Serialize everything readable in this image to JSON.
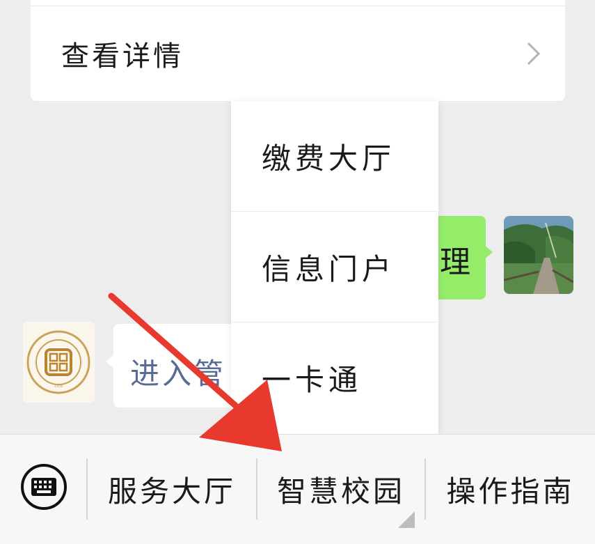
{
  "card": {
    "row_label": "查看详情",
    "chevron_icon": "chevron-right-icon"
  },
  "chat": {
    "outgoing_text": "理",
    "incoming_text": "进入管",
    "outgoing_bubble_color": "#95ec69",
    "link_color": "#576b95"
  },
  "popup_menu": {
    "items": [
      {
        "label": "缴费大厅"
      },
      {
        "label": "信息门户"
      },
      {
        "label": "一卡通"
      }
    ]
  },
  "bottom_bar": {
    "keyboard_icon": "keyboard-icon",
    "tabs": [
      {
        "label": "服务大厅"
      },
      {
        "label": "智慧校园"
      },
      {
        "label": "操作指南"
      }
    ]
  },
  "annotation": {
    "arrow_color": "#e8392f"
  }
}
